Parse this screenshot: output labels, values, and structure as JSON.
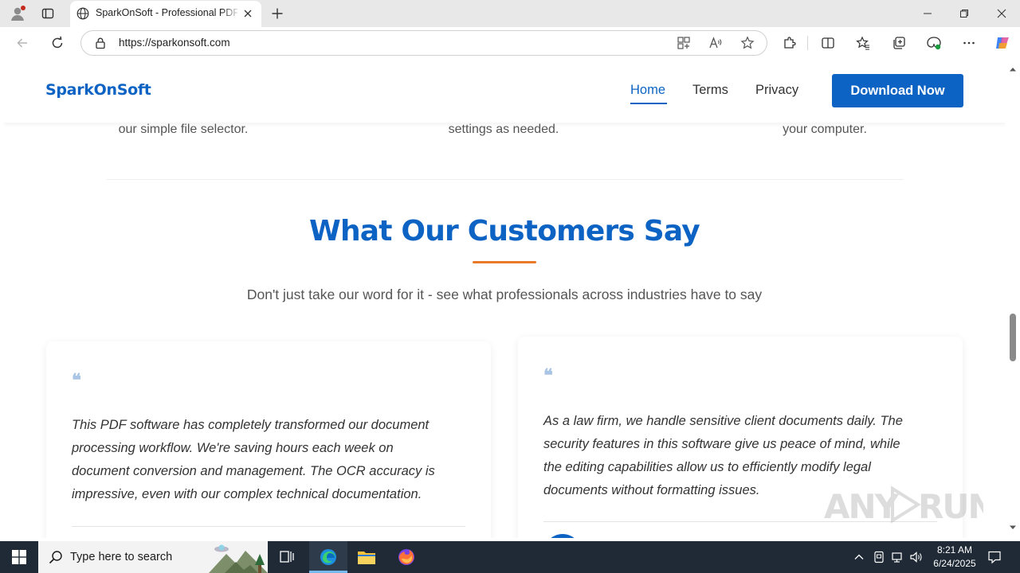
{
  "browser": {
    "tab_title": "SparkOnSoft - Professional PDF Software",
    "url": "https://sparkonsoft.com"
  },
  "site": {
    "logo": "SparkOnSoft",
    "nav": [
      {
        "label": "Home",
        "active": true
      },
      {
        "label": "Terms",
        "active": false
      },
      {
        "label": "Privacy",
        "active": false
      }
    ],
    "download_label": "Download Now",
    "brand_color": "#0d63c4",
    "accent_color": "#e87a2a"
  },
  "steps_partial": [
    "our simple file selector.",
    "settings as needed.",
    "your computer."
  ],
  "testimonials": {
    "title": "What Our Customers Say",
    "subtitle": "Don't just take our word for it - see what professionals across industries have to say",
    "quote_glyph": "❝",
    "cards": [
      {
        "lines": [
          "This PDF software has completely transformed our document",
          "processing workflow. We're saving hours each week on",
          "document conversion and management. The OCR accuracy is",
          "impressive, even with our complex technical documentation."
        ]
      },
      {
        "lines": [
          "As a law firm, we handle sensitive client documents daily. The",
          "security features in this software give us peace of mind, while",
          "the editing capabilities allow us to efficiently modify legal",
          "documents without formatting issues."
        ]
      }
    ]
  },
  "watermark": "ANY RUN",
  "taskbar": {
    "search_placeholder": "Type here to search",
    "time": "8:21 AM",
    "date": "6/24/2025"
  },
  "icons": {
    "profile": "profile-icon",
    "tab_actions": "tab-actions-icon",
    "site_favicon": "globe-icon",
    "close": "close-icon",
    "new_tab": "plus-icon",
    "back": "back-arrow-icon",
    "refresh": "refresh-icon",
    "site_info": "lock-icon",
    "app": "app-available-icon",
    "read_aloud": "read-aloud-icon",
    "favorite": "star-icon",
    "extensions": "puzzle-icon",
    "split": "split-screen-icon",
    "favorites": "favorites-icon",
    "collections": "collections-icon",
    "performance": "browser-essentials-icon",
    "more": "more-icon",
    "copilot": "copilot-icon"
  }
}
